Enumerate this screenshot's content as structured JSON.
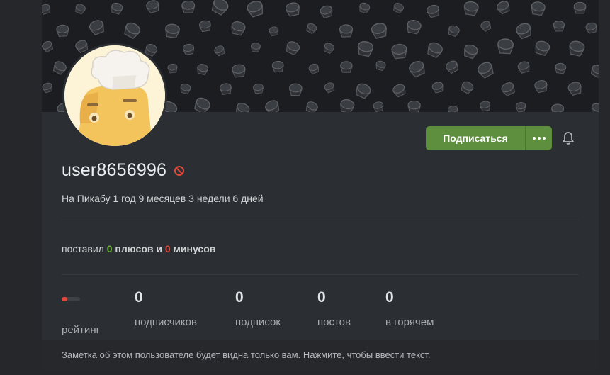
{
  "profile": {
    "username": "user8656996",
    "member_since": "На Пикабу 1 год 9 месяцев 3 недели 6 дней",
    "subscribe_label": "Подписаться",
    "votes": {
      "prefix": "поставил ",
      "plus_count": "0",
      "plus_word": " плюсов и ",
      "minus_count": "0",
      "minus_word": " минусов"
    },
    "stats": [
      {
        "value": "",
        "label": "рейтинг"
      },
      {
        "value": "0",
        "label": "подписчиков"
      },
      {
        "value": "0",
        "label": "подписок"
      },
      {
        "value": "0",
        "label": "постов"
      },
      {
        "value": "0",
        "label": "в горячем"
      }
    ],
    "note_placeholder": "Заметка об этом пользователе будет видна только вам. Нажмите, чтобы ввести текст."
  },
  "colors": {
    "accent": "#5e8f3e",
    "plus": "#6fb53c",
    "minus": "#e2483c",
    "banned": "#e2483c"
  },
  "icons": [
    "ban-icon",
    "more-dots-icon",
    "bell-icon"
  ]
}
